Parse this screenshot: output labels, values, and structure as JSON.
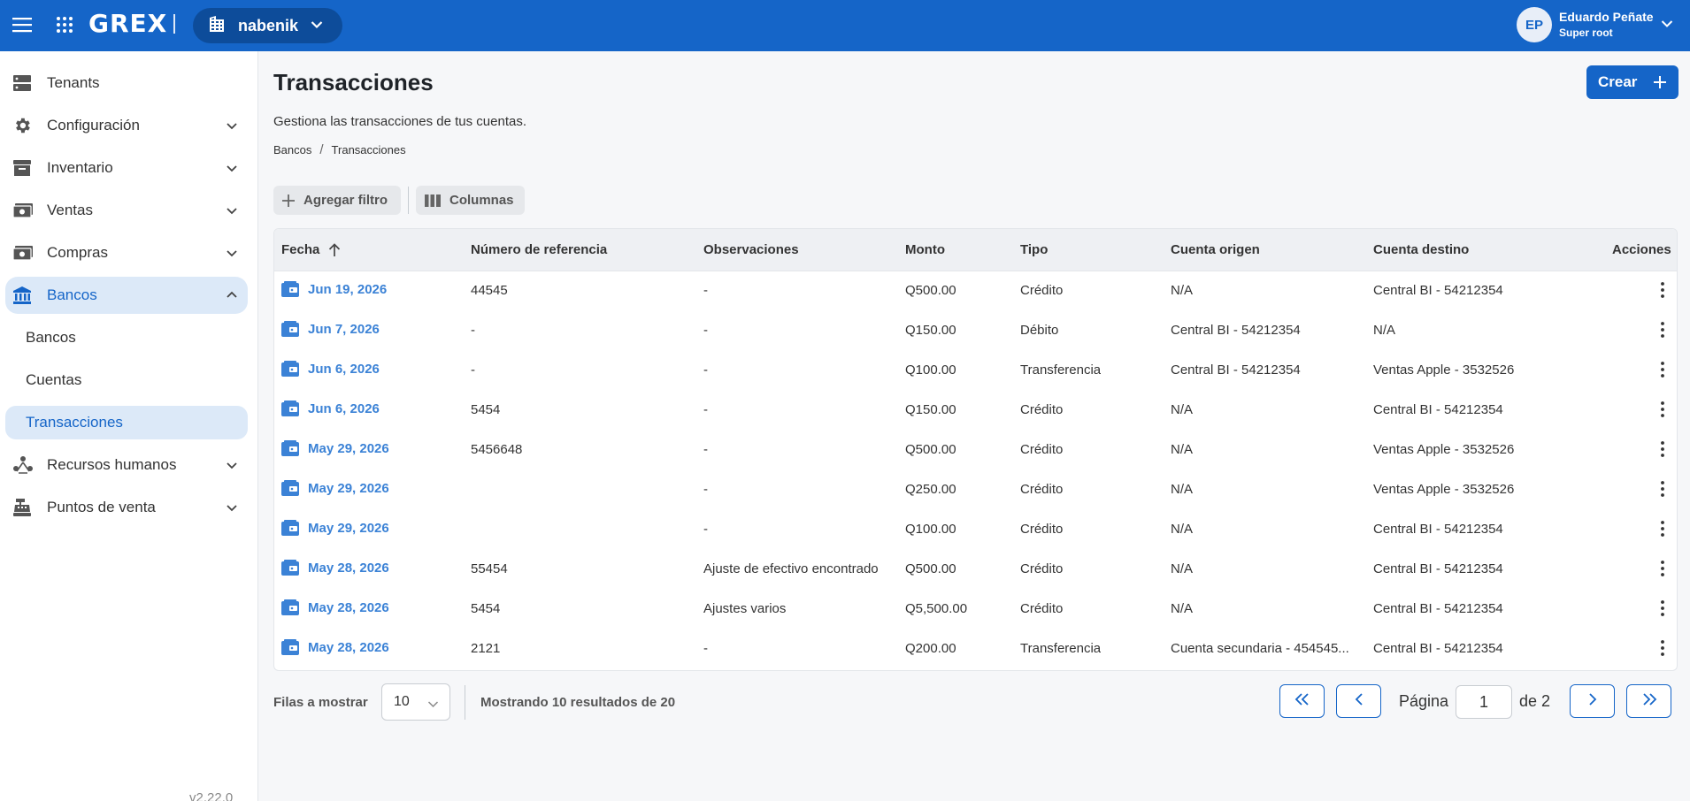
{
  "app": {
    "logo": "GREX",
    "tenant": "nabenik",
    "user": {
      "initials": "EP",
      "name": "Eduardo Peñate",
      "role": "Super root"
    }
  },
  "sidebar": {
    "items": [
      {
        "label": "Tenants",
        "icon": "server-icon"
      },
      {
        "label": "Configuración",
        "icon": "gear-icon"
      },
      {
        "label": "Inventario",
        "icon": "archive-icon"
      },
      {
        "label": "Ventas",
        "icon": "cash-icon"
      },
      {
        "label": "Compras",
        "icon": "cash-icon"
      },
      {
        "label": "Bancos",
        "icon": "bank-icon"
      },
      {
        "label": "Recursos humanos",
        "icon": "people-icon"
      },
      {
        "label": "Puntos de venta",
        "icon": "cash-register-icon"
      }
    ],
    "subitems": [
      {
        "label": "Bancos"
      },
      {
        "label": "Cuentas"
      },
      {
        "label": "Transacciones"
      }
    ],
    "version": "v2.22.0"
  },
  "page": {
    "title": "Transacciones",
    "subtitle": "Gestiona las transacciones de tus cuentas.",
    "create_label": "Crear",
    "breadcrumb": [
      "Bancos",
      "Transacciones"
    ],
    "add_filter_label": "Agregar filtro",
    "columns_label": "Columnas"
  },
  "table": {
    "columns": [
      "Fecha",
      "Número de referencia",
      "Observaciones",
      "Monto",
      "Tipo",
      "Cuenta origen",
      "Cuenta destino",
      "Acciones"
    ],
    "rows": [
      {
        "fecha": "Jun 19, 2026",
        "ref": "44545",
        "obs": "-",
        "monto": "Q500.00",
        "tipo": "Crédito",
        "origen": "N/A",
        "destino": "Central BI - 54212354"
      },
      {
        "fecha": "Jun 7, 2026",
        "ref": "-",
        "obs": "-",
        "monto": "Q150.00",
        "tipo": "Débito",
        "origen": "Central BI - 54212354",
        "destino": "N/A"
      },
      {
        "fecha": "Jun 6, 2026",
        "ref": "-",
        "obs": "-",
        "monto": "Q100.00",
        "tipo": "Transferencia",
        "origen": "Central BI - 54212354",
        "destino": "Ventas Apple - 3532526"
      },
      {
        "fecha": "Jun 6, 2026",
        "ref": "5454",
        "obs": "-",
        "monto": "Q150.00",
        "tipo": "Crédito",
        "origen": "N/A",
        "destino": "Central BI - 54212354"
      },
      {
        "fecha": "May 29, 2026",
        "ref": "5456648",
        "obs": "-",
        "monto": "Q500.00",
        "tipo": "Crédito",
        "origen": "N/A",
        "destino": "Ventas Apple - 3532526"
      },
      {
        "fecha": "May 29, 2026",
        "ref": "",
        "obs": "-",
        "monto": "Q250.00",
        "tipo": "Crédito",
        "origen": "N/A",
        "destino": "Ventas Apple - 3532526"
      },
      {
        "fecha": "May 29, 2026",
        "ref": "",
        "obs": "-",
        "monto": "Q100.00",
        "tipo": "Crédito",
        "origen": "N/A",
        "destino": "Central BI - 54212354"
      },
      {
        "fecha": "May 28, 2026",
        "ref": "55454",
        "obs": "Ajuste de efectivo encontrado",
        "monto": "Q500.00",
        "tipo": "Crédito",
        "origen": "N/A",
        "destino": "Central BI - 54212354"
      },
      {
        "fecha": "May 28, 2026",
        "ref": "5454",
        "obs": "Ajustes varios",
        "monto": "Q5,500.00",
        "tipo": "Crédito",
        "origen": "N/A",
        "destino": "Central BI - 54212354"
      },
      {
        "fecha": "May 28, 2026",
        "ref": "2121",
        "obs": "-",
        "monto": "Q200.00",
        "tipo": "Transferencia",
        "origen": "Cuenta secundaria - 454545...",
        "destino": "Central BI - 54212354"
      }
    ]
  },
  "pagination": {
    "rows_label": "Filas a mostrar",
    "rows_value": "10",
    "showing": "Mostrando 10 resultados de 20",
    "page_label": "Página",
    "page_value": "1",
    "of_label": "de 2"
  },
  "colors": {
    "primary": "#1565c8",
    "link": "#3b82d6",
    "active_bg": "#dce9f8"
  }
}
